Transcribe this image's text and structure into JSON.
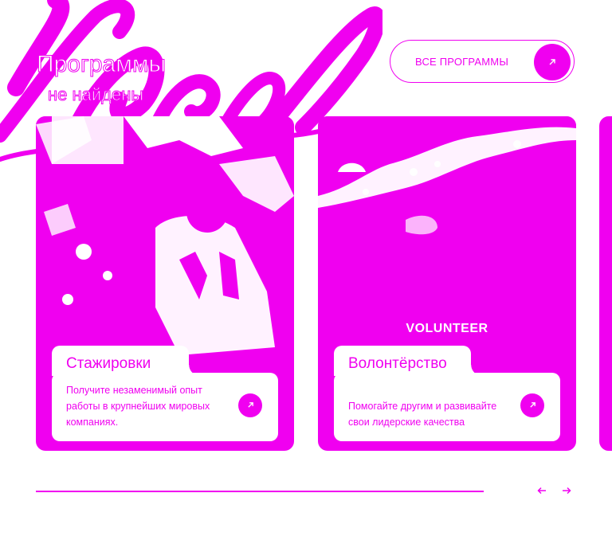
{
  "header": {
    "title": "Программы",
    "subtitle": "не найдены"
  },
  "all_programs_button": {
    "label": "ВСЕ ПРОГРАММЫ",
    "icon": "arrow-up-right-icon"
  },
  "cards": [
    {
      "title": "Стажировки",
      "description": "Получите незаменимый опыт работы в крупнейших мировых компаниях.",
      "icon": "arrow-up-right-icon"
    },
    {
      "title": "Волонтёрство",
      "description": "Помогайте другим и развивайте свои лидерские качества",
      "photo_caption": "VOLUNTEER",
      "icon": "arrow-up-right-icon"
    }
  ],
  "carousel": {
    "prev_icon": "arrow-left-icon",
    "next_icon": "arrow-right-icon"
  },
  "colors": {
    "accent": "#f000f0",
    "background": "#ffffff"
  }
}
